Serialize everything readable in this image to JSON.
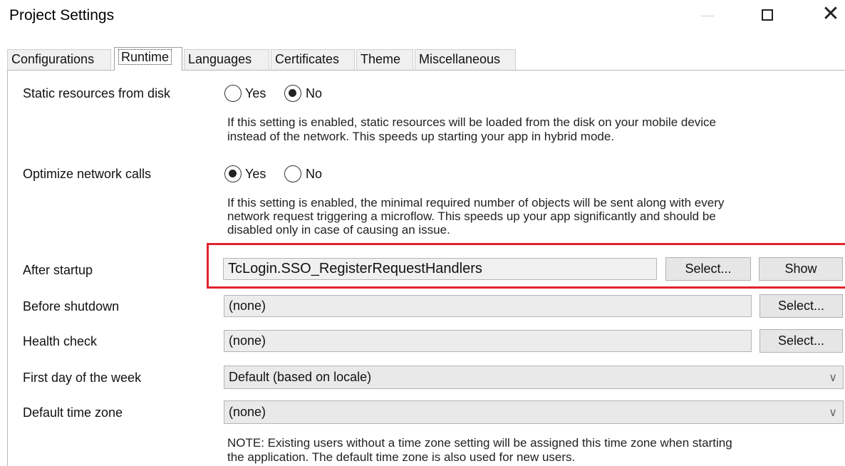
{
  "window": {
    "title": "Project Settings",
    "minimize_icon": "minimize-icon",
    "maximize_icon": "maximize-icon",
    "close_glyph": "✕"
  },
  "tabs": [
    {
      "label": "Configurations"
    },
    {
      "label": "Runtime"
    },
    {
      "label": "Languages"
    },
    {
      "label": "Certificates"
    },
    {
      "label": "Theme"
    },
    {
      "label": "Miscellaneous"
    }
  ],
  "settings": {
    "static_resources": {
      "label": "Static resources from disk",
      "options": [
        "Yes",
        "No"
      ],
      "selected": "No",
      "description": [
        "If this setting is enabled, static resources will be loaded from the disk on your mobile device",
        "instead of the network. This speeds up starting your app in hybrid mode."
      ]
    },
    "optimize_network": {
      "label": "Optimize network calls",
      "options": [
        "Yes",
        "No"
      ],
      "selected": "Yes",
      "description": [
        "If this setting is enabled, the minimal required number of objects will be sent along with every",
        "network request triggering a microflow. This speeds up your app significantly and should be",
        "disabled only in case of causing an issue."
      ]
    },
    "after_startup": {
      "label": "After startup",
      "value": "TcLogin.SSO_RegisterRequestHandlers",
      "select_label": "Select...",
      "show_label": "Show"
    },
    "before_shutdown": {
      "label": "Before shutdown",
      "value": "(none)",
      "select_label": "Select..."
    },
    "health_check": {
      "label": "Health check",
      "value": "(none)",
      "select_label": "Select..."
    },
    "first_day": {
      "label": "First day of the week",
      "value": "Default (based on locale)"
    },
    "time_zone": {
      "label": "Default time zone",
      "value": "(none)",
      "note": [
        "NOTE: Existing users without a time zone setting will be assigned this time zone when starting",
        "the application. The default time zone is also used for new users."
      ]
    }
  },
  "colors": {
    "highlight": "#e0242f"
  }
}
